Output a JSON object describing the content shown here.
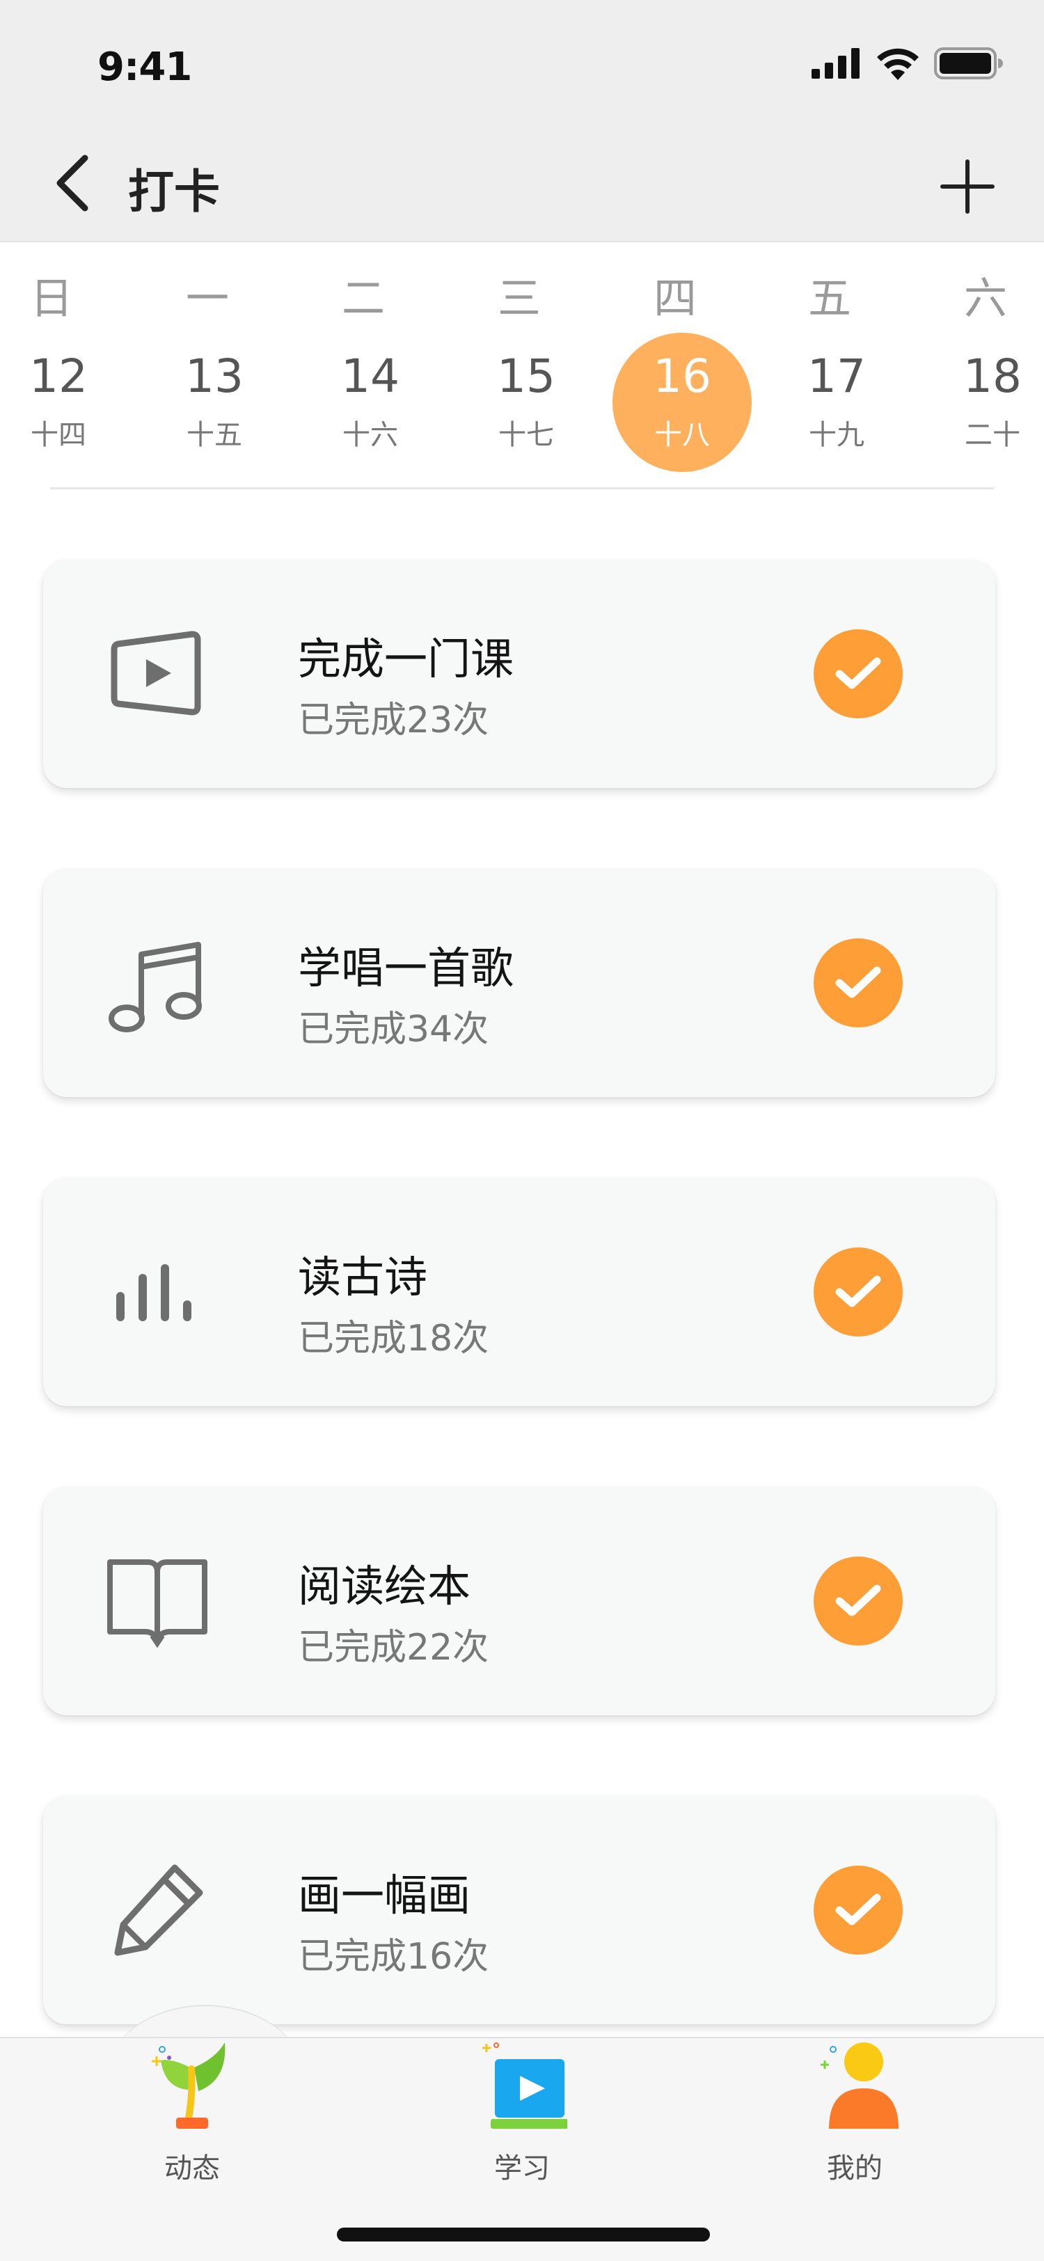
{
  "status_bar": {
    "time": "9:41"
  },
  "nav": {
    "title": "打卡"
  },
  "calendar": {
    "weekdays": [
      "日",
      "一",
      "二",
      "三",
      "四",
      "五",
      "六"
    ],
    "dates": [
      {
        "day": "12",
        "lunar": "十四",
        "selected": false
      },
      {
        "day": "13",
        "lunar": "十五",
        "selected": false
      },
      {
        "day": "14",
        "lunar": "十六",
        "selected": false
      },
      {
        "day": "15",
        "lunar": "十七",
        "selected": false
      },
      {
        "day": "16",
        "lunar": "十八",
        "selected": true
      },
      {
        "day": "17",
        "lunar": "十九",
        "selected": false
      },
      {
        "day": "18",
        "lunar": "二十",
        "selected": false
      }
    ],
    "selected_color": "#ffb05c"
  },
  "tasks": [
    {
      "title": "完成一门课",
      "subtitle": "已完成23次",
      "icon": "video-play-icon",
      "done": true
    },
    {
      "title": "学唱一首歌",
      "subtitle": "已完成34次",
      "icon": "music-note-icon",
      "done": true
    },
    {
      "title": "读古诗",
      "subtitle": "已完成18次",
      "icon": "audio-bars-icon",
      "done": true
    },
    {
      "title": "阅读绘本",
      "subtitle": "已完成22次",
      "icon": "open-book-icon",
      "done": true
    },
    {
      "title": "画一幅画",
      "subtitle": "已完成16次",
      "icon": "pencil-icon",
      "done": true
    }
  ],
  "colors": {
    "accent": "#fe9e37",
    "header_bg": "#eeeeee",
    "card_bg": "#f7f8f8"
  },
  "tab_bar": {
    "tabs": [
      {
        "label": "动态",
        "icon": "sprout-icon"
      },
      {
        "label": "学习",
        "icon": "video-screen-icon"
      },
      {
        "label": "我的",
        "icon": "person-icon"
      }
    ]
  }
}
